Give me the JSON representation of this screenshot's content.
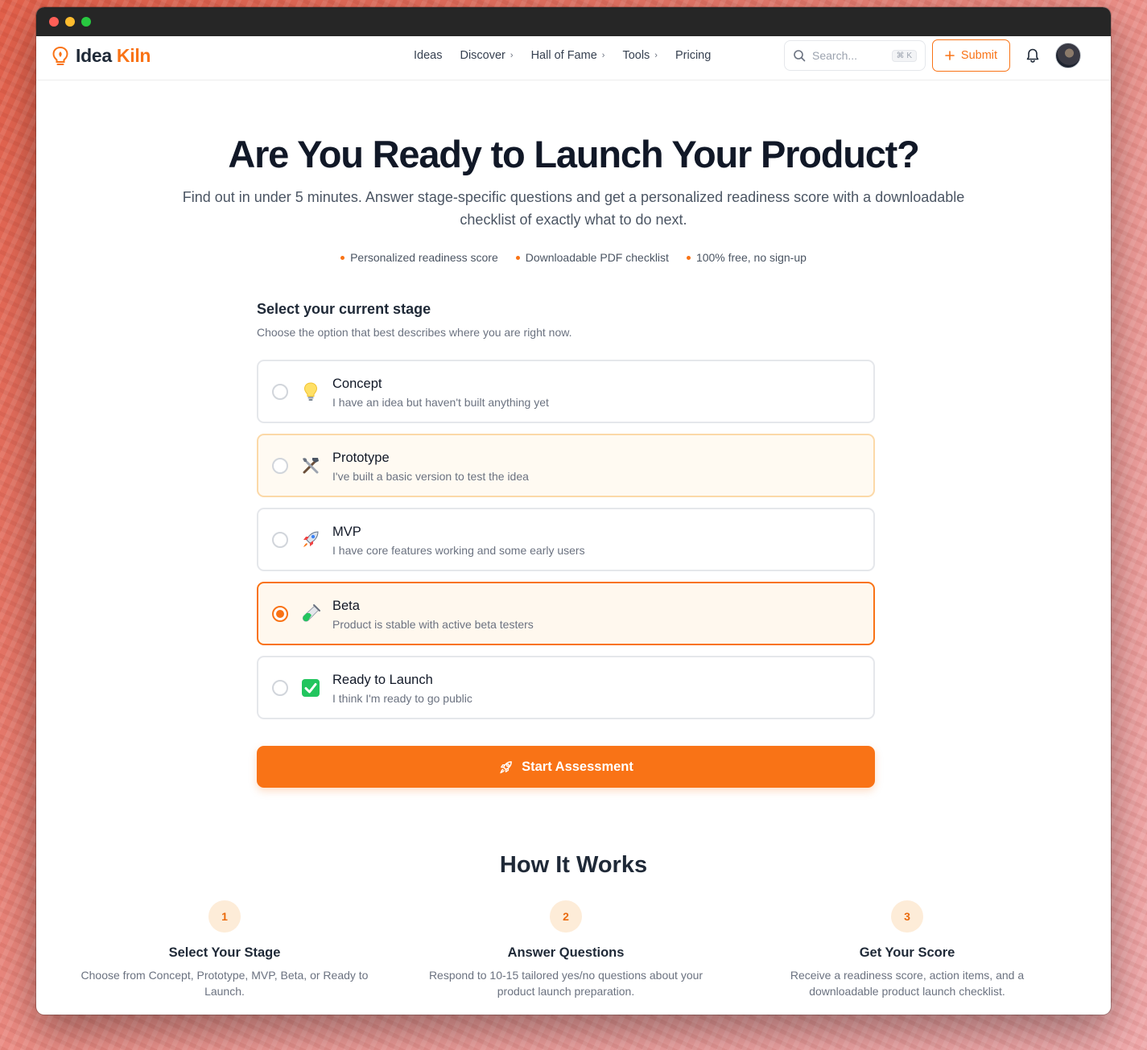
{
  "nav": {
    "logo_text_1": "Idea",
    "logo_text_2": "Kiln",
    "links": [
      "Ideas",
      "Discover",
      "Hall of Fame",
      "Tools",
      "Pricing"
    ],
    "search_placeholder": "Search...",
    "search_shortcut": "⌘ K",
    "submit_label": "Submit"
  },
  "hero": {
    "title": "Are You Ready to Launch Your Product?",
    "subtitle": "Find out in under 5 minutes. Answer stage-specific questions and get a personalized readiness score with a downloadable checklist of exactly what to do next.",
    "features": [
      "Personalized readiness score",
      "Downloadable PDF checklist",
      "100% free, no sign-up"
    ]
  },
  "stage": {
    "heading": "Select your current stage",
    "subheading": "Choose the option that best describes where you are right now.",
    "selected": "Beta",
    "options": [
      {
        "title": "Concept",
        "desc": "I have an idea but haven't built anything yet",
        "icon": "lightbulb-icon"
      },
      {
        "title": "Prototype",
        "desc": "I've built a basic version to test the idea",
        "icon": "tools-icon"
      },
      {
        "title": "MVP",
        "desc": "I have core features working and some early users",
        "icon": "rocket-icon"
      },
      {
        "title": "Beta",
        "desc": "Product is stable with active beta testers",
        "icon": "test-tube-icon"
      },
      {
        "title": "Ready to Launch",
        "desc": "I think I'm ready to go public",
        "icon": "check-mark-button-icon"
      }
    ],
    "start_label": "Start Assessment"
  },
  "how": {
    "title": "How It Works",
    "steps": [
      {
        "num": "1",
        "title": "Select Your Stage",
        "desc": "Choose from Concept, Prototype, MVP, Beta, or Ready to Launch."
      },
      {
        "num": "2",
        "title": "Answer Questions",
        "desc": "Respond to 10-15 tailored yes/no questions about your product launch preparation."
      },
      {
        "num": "3",
        "title": "Get Your Score",
        "desc": "Receive a readiness score, action items, and a downloadable product launch checklist."
      }
    ]
  },
  "colors": {
    "accent": "#f97316",
    "text_dark": "#111827",
    "muted": "#6b7280"
  }
}
